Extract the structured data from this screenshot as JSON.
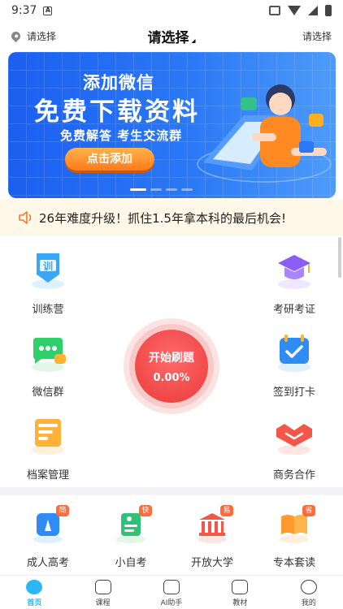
{
  "status": {
    "time": "9:37",
    "badge": "A"
  },
  "header": {
    "location": "请选择",
    "title": "请选择",
    "right": "请选择"
  },
  "banner": {
    "line1": "添加微信",
    "line2": "免费下载资料",
    "line3": "免费解答  考生交流群",
    "cta": "点击添加"
  },
  "notice": {
    "text": "26年难度升级！抓住1.5年拿本科的最后机会!"
  },
  "features": {
    "f1": "训练营",
    "f2": "考研考证",
    "f3": "微信群",
    "f4": "签到打卡",
    "f5": "档案管理",
    "f6": "商务合作"
  },
  "quiz": {
    "title": "开始刷题",
    "progress": "0.00%"
  },
  "courses": [
    {
      "label": "成人高考",
      "tag": "简"
    },
    {
      "label": "小自考",
      "tag": "快"
    },
    {
      "label": "开放大学",
      "tag": "易"
    },
    {
      "label": "专本套读",
      "tag": "省"
    }
  ],
  "tabs": [
    {
      "label": "首页"
    },
    {
      "label": "课程"
    },
    {
      "label": "AI助手"
    },
    {
      "label": "教材"
    },
    {
      "label": "我的"
    }
  ],
  "colors": {
    "primary": "#2bb7f5",
    "banner": "#2a78f6",
    "quiz": "#ea3a3a",
    "notice_bg": "#fff7e8"
  }
}
